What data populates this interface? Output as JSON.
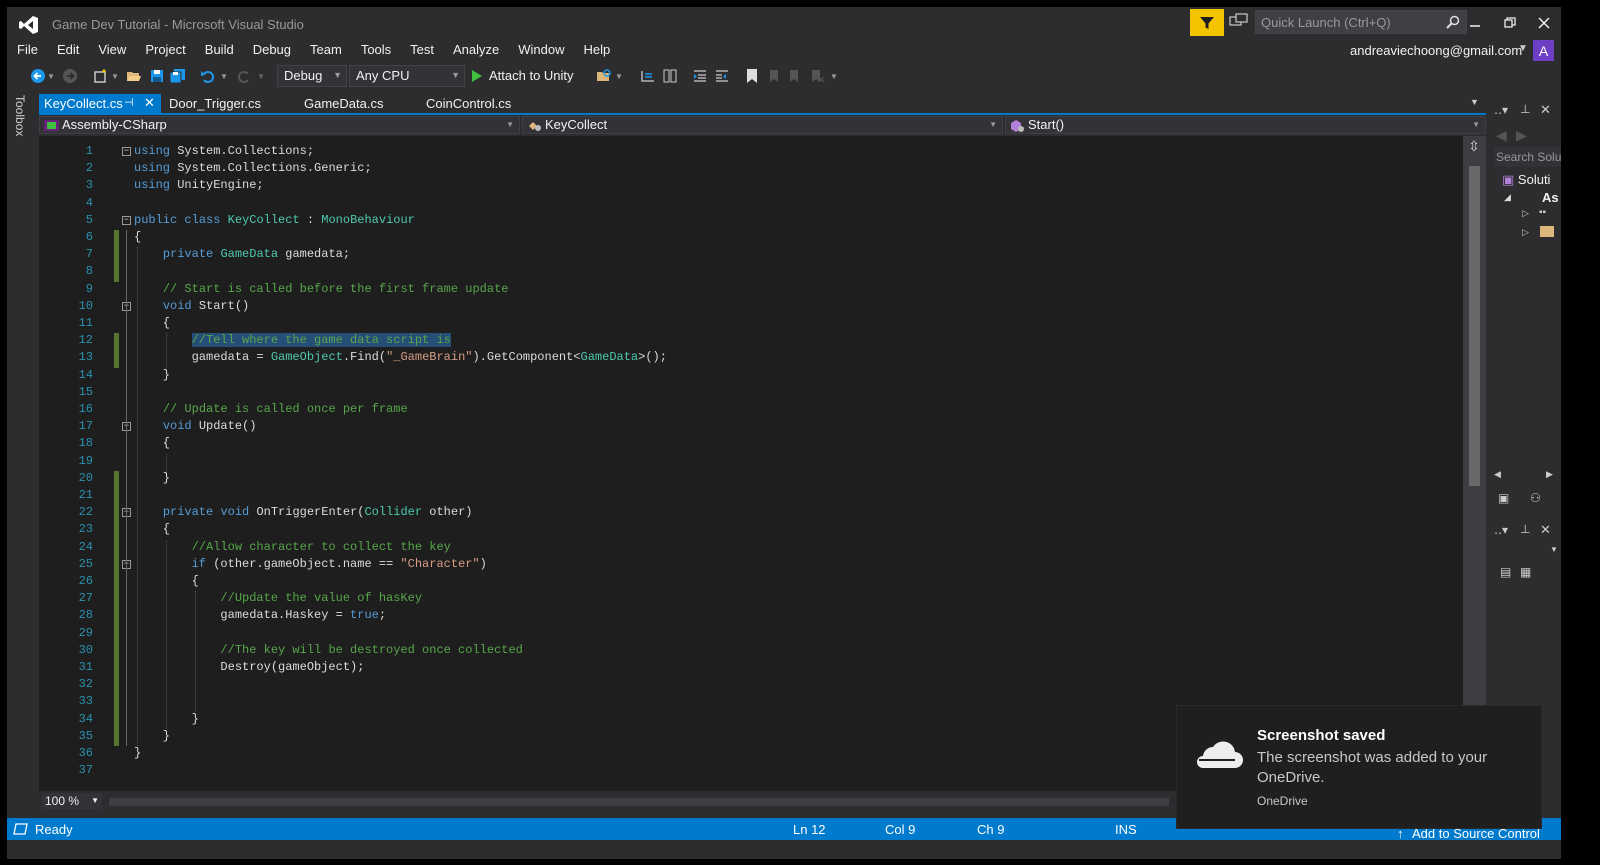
{
  "window": {
    "title": "Game Dev Tutorial - Microsoft Visual Studio",
    "quick_launch_placeholder": "Quick Launch (Ctrl+Q)",
    "account": "andreaviechoong@gmail.com",
    "avatar_letter": "A"
  },
  "menu": [
    "File",
    "Edit",
    "View",
    "Project",
    "Build",
    "Debug",
    "Team",
    "Tools",
    "Test",
    "Analyze",
    "Window",
    "Help"
  ],
  "toolbar": {
    "configuration": "Debug",
    "platform": "Any CPU",
    "attach_label": "Attach to Unity"
  },
  "toolbox_label": "Toolbox",
  "tabs": [
    {
      "label": "KeyCollect.cs",
      "active": true
    },
    {
      "label": "Door_Trigger.cs",
      "active": false
    },
    {
      "label": "GameData.cs",
      "active": false
    },
    {
      "label": "CoinControl.cs",
      "active": false
    }
  ],
  "navigation": {
    "project": "Assembly-CSharp",
    "type": "KeyCollect",
    "member": "Start()"
  },
  "code_lines": [
    "using System.Collections;",
    "using System.Collections.Generic;",
    "using UnityEngine;",
    "",
    "public class KeyCollect : MonoBehaviour",
    "{",
    "    private GameData gamedata;",
    "",
    "    // Start is called before the first frame update",
    "    void Start()",
    "    {",
    "        //Tell where the game data script is",
    "        gamedata = GameObject.Find(\"_GameBrain\").GetComponent<GameData>();",
    "    }",
    "",
    "    // Update is called once per frame",
    "    void Update()",
    "    {",
    "",
    "    }",
    "",
    "    private void OnTriggerEnter(Collider other)",
    "    {",
    "        //Allow character to collect the key",
    "        if (other.gameObject.name == \"Character\")",
    "        {",
    "            //Update the value of hasKey",
    "            gamedata.Haskey = true;",
    "",
    "            //The key will be destroyed once collected",
    "            Destroy(gameObject);",
    "",
    "",
    "        }",
    "    }",
    "}",
    ""
  ],
  "zoom": "100 %",
  "solution_explorer": {
    "search_placeholder": "Search Solu",
    "solution_label": "Soluti",
    "project_label": "As"
  },
  "status": {
    "state": "Ready",
    "line": "Ln 12",
    "column": "Col 9",
    "char": "Ch 9",
    "mode": "INS",
    "source_control": "Add to Source Control"
  },
  "toast": {
    "title": "Screenshot saved",
    "body": "The screenshot was added to your OneDrive.",
    "source": "OneDrive"
  },
  "colors": {
    "accent": "#007acc",
    "background": "#2d2d30",
    "editor": "#1e1e1e",
    "keyword": "#569cd6",
    "type": "#4ec9b0",
    "comment": "#57a64a",
    "string": "#d69d85"
  }
}
